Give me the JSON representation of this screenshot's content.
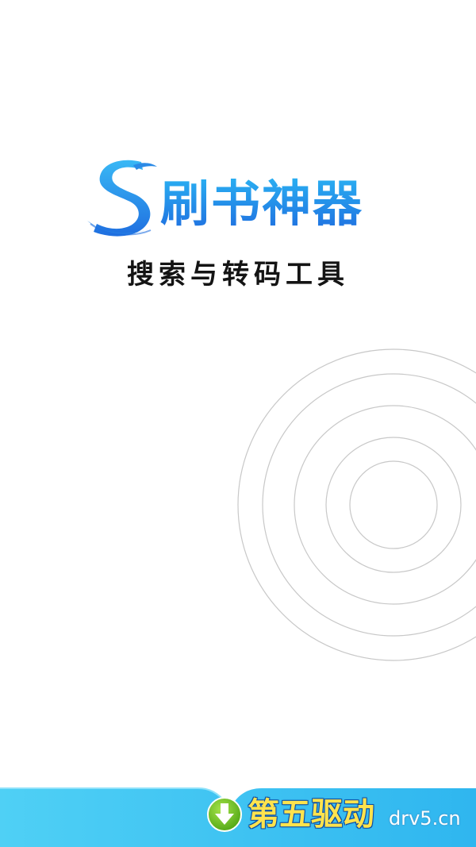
{
  "app": {
    "name": "刷书神器",
    "tagline": "搜索与转码工具",
    "logo_letter_icon": "s-swoosh-logo-icon"
  },
  "watermark": {
    "brand": "第五驱动",
    "domain": "drv5.cn",
    "icon": "download-arrow-icon"
  },
  "colors": {
    "brand_blue": "#1f8fe8",
    "brand_blue_dark": "#1f6fe0",
    "tagline": "#141414",
    "ring": "#c8c8c8",
    "footer_blue": "#3ec7f3",
    "watermark_yellow": "#ffe34d",
    "watermark_green": "#6cc21e"
  }
}
